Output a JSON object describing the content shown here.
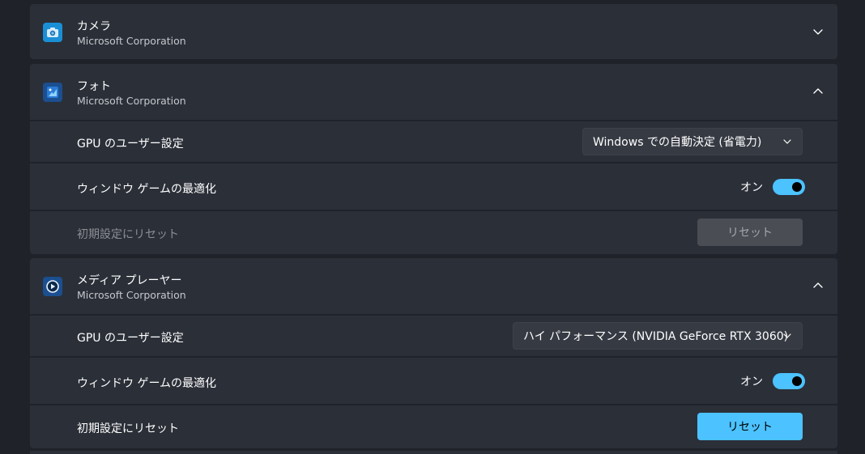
{
  "apps": [
    {
      "name": "カメラ",
      "publisher": "Microsoft Corporation",
      "icon": "camera-app-icon",
      "expanded": false
    },
    {
      "name": "フォト",
      "publisher": "Microsoft Corporation",
      "icon": "photos-app-icon",
      "expanded": true,
      "gpu_label": "GPU のユーザー設定",
      "gpu_value": "Windows での自動決定 (省電力)",
      "windowed_label": "ウィンドウ ゲームの最適化",
      "windowed_state": "オン",
      "reset_label": "初期設定にリセット",
      "reset_button": "リセット",
      "reset_enabled": false
    },
    {
      "name": "メディア プレーヤー",
      "publisher": "Microsoft Corporation",
      "icon": "media-player-app-icon",
      "expanded": true,
      "gpu_label": "GPU のユーザー設定",
      "gpu_value": "ハイ パフォーマンス (NVIDIA GeForce RTX 3060)",
      "windowed_label": "ウィンドウ ゲームの最適化",
      "windowed_state": "オン",
      "reset_label": "初期設定にリセット",
      "reset_button": "リセット",
      "reset_enabled": true
    }
  ],
  "colors": {
    "accent": "#4cc2ff",
    "card": "#2b2f38",
    "background": "#1f2229"
  }
}
